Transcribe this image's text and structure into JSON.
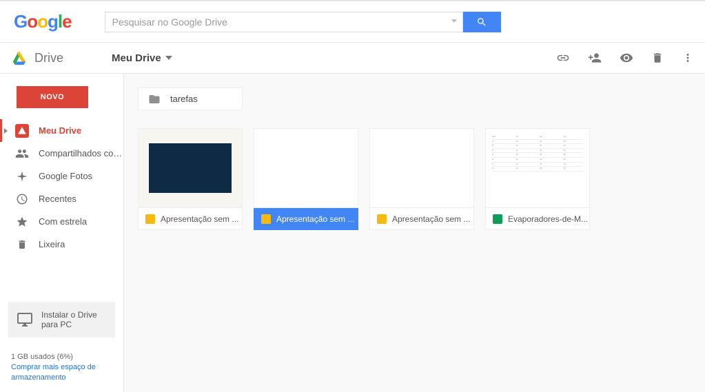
{
  "header": {
    "search_placeholder": "Pesquisar no Google Drive"
  },
  "toolbar": {
    "app_name": "Drive",
    "breadcrumb": "Meu Drive"
  },
  "sidebar": {
    "new_label": "NOVO",
    "items": [
      {
        "label": "Meu Drive"
      },
      {
        "label": "Compartilhados comigo"
      },
      {
        "label": "Google Fotos"
      },
      {
        "label": "Recentes"
      },
      {
        "label": "Com estrela"
      },
      {
        "label": "Lixeira"
      }
    ],
    "install_label": "Instalar o Drive para PC",
    "storage_used": "1 GB usados (6%)",
    "buy_more": "Comprar mais espaço de armazenamento"
  },
  "content": {
    "folders": [
      {
        "name": "tarefas"
      }
    ],
    "files": [
      {
        "name": "Apresentação sem ...",
        "type": "slides"
      },
      {
        "name": "Apresentação sem ...",
        "type": "slides",
        "selected": true
      },
      {
        "name": "Apresentação sem ...",
        "type": "slides"
      },
      {
        "name": "Evaporadores-de-M...",
        "type": "sheets"
      }
    ]
  }
}
